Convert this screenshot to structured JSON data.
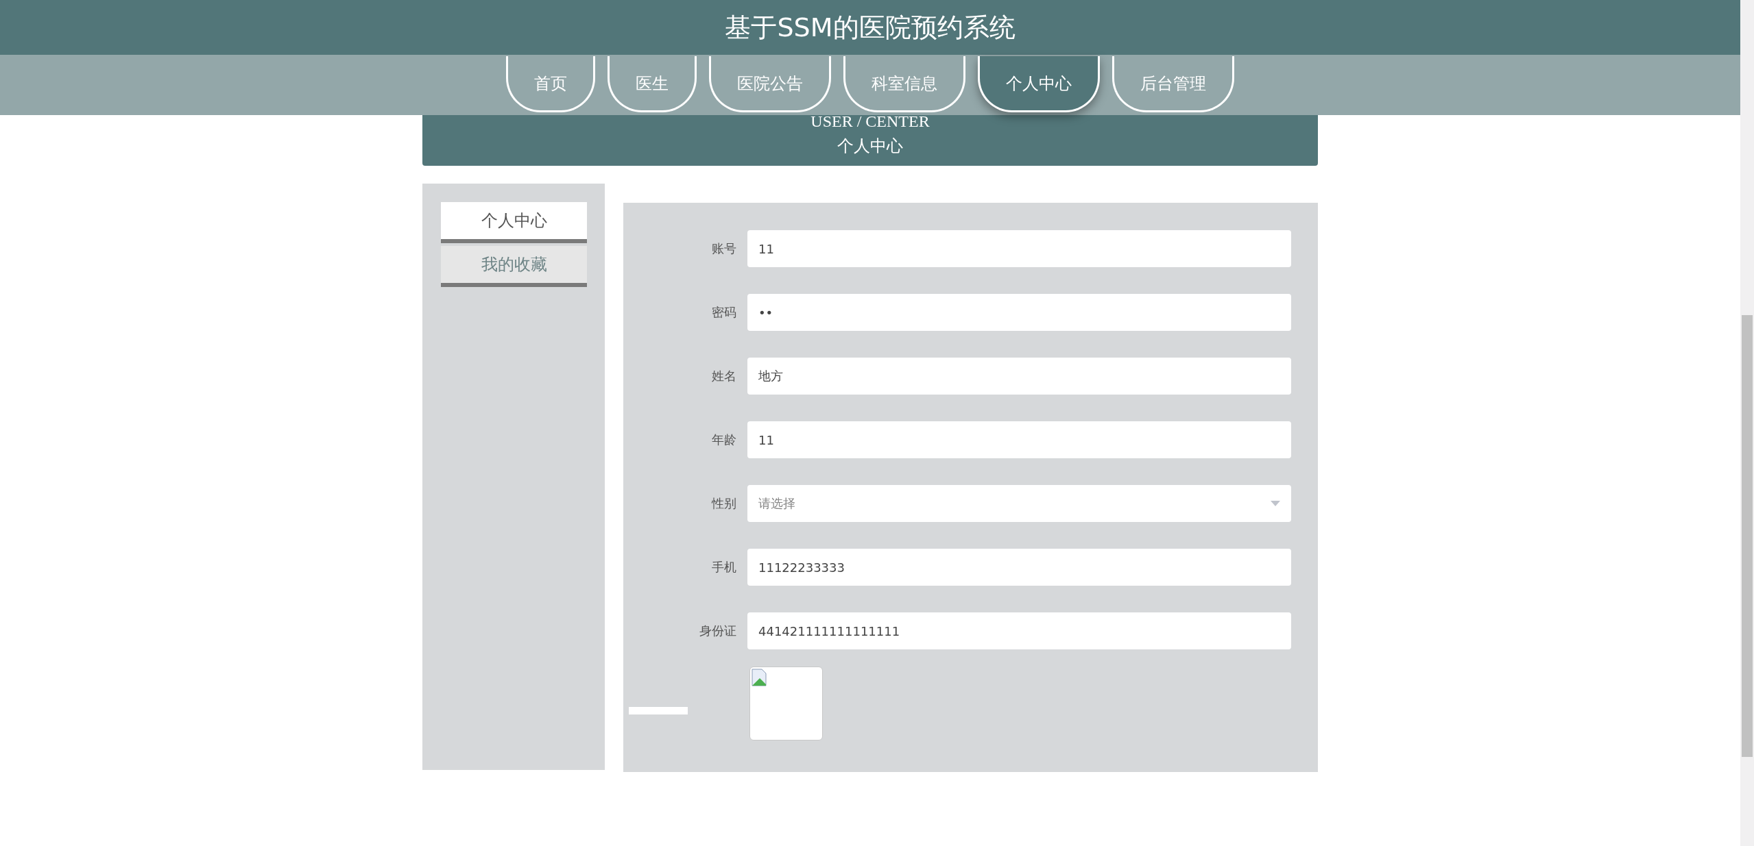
{
  "header": {
    "title": "基于SSM的医院预约系统"
  },
  "nav": [
    {
      "label": "首页",
      "selected": false
    },
    {
      "label": "医生",
      "selected": false
    },
    {
      "label": "医院公告",
      "selected": false
    },
    {
      "label": "科室信息",
      "selected": false
    },
    {
      "label": "个人中心",
      "selected": true
    },
    {
      "label": "后台管理",
      "selected": false
    }
  ],
  "banner": {
    "subtitle": "USER / CENTER",
    "title": "个人中心"
  },
  "sidebar": {
    "items": [
      {
        "label": "个人中心",
        "selected": true
      },
      {
        "label": "我的收藏",
        "selected": false
      }
    ]
  },
  "form": {
    "fields": [
      {
        "kind": "text",
        "label": "账号",
        "value": "11"
      },
      {
        "kind": "text",
        "label": "密码",
        "value": "••"
      },
      {
        "kind": "text",
        "label": "姓名",
        "value": "地方"
      },
      {
        "kind": "text",
        "label": "年龄",
        "value": "11"
      },
      {
        "kind": "select",
        "label": "性别",
        "placeholder": "请选择"
      },
      {
        "kind": "text",
        "label": "手机",
        "value": "11122233333"
      },
      {
        "kind": "text",
        "label": "身份证",
        "value": "441421111111111111"
      },
      {
        "kind": "image"
      }
    ]
  }
}
